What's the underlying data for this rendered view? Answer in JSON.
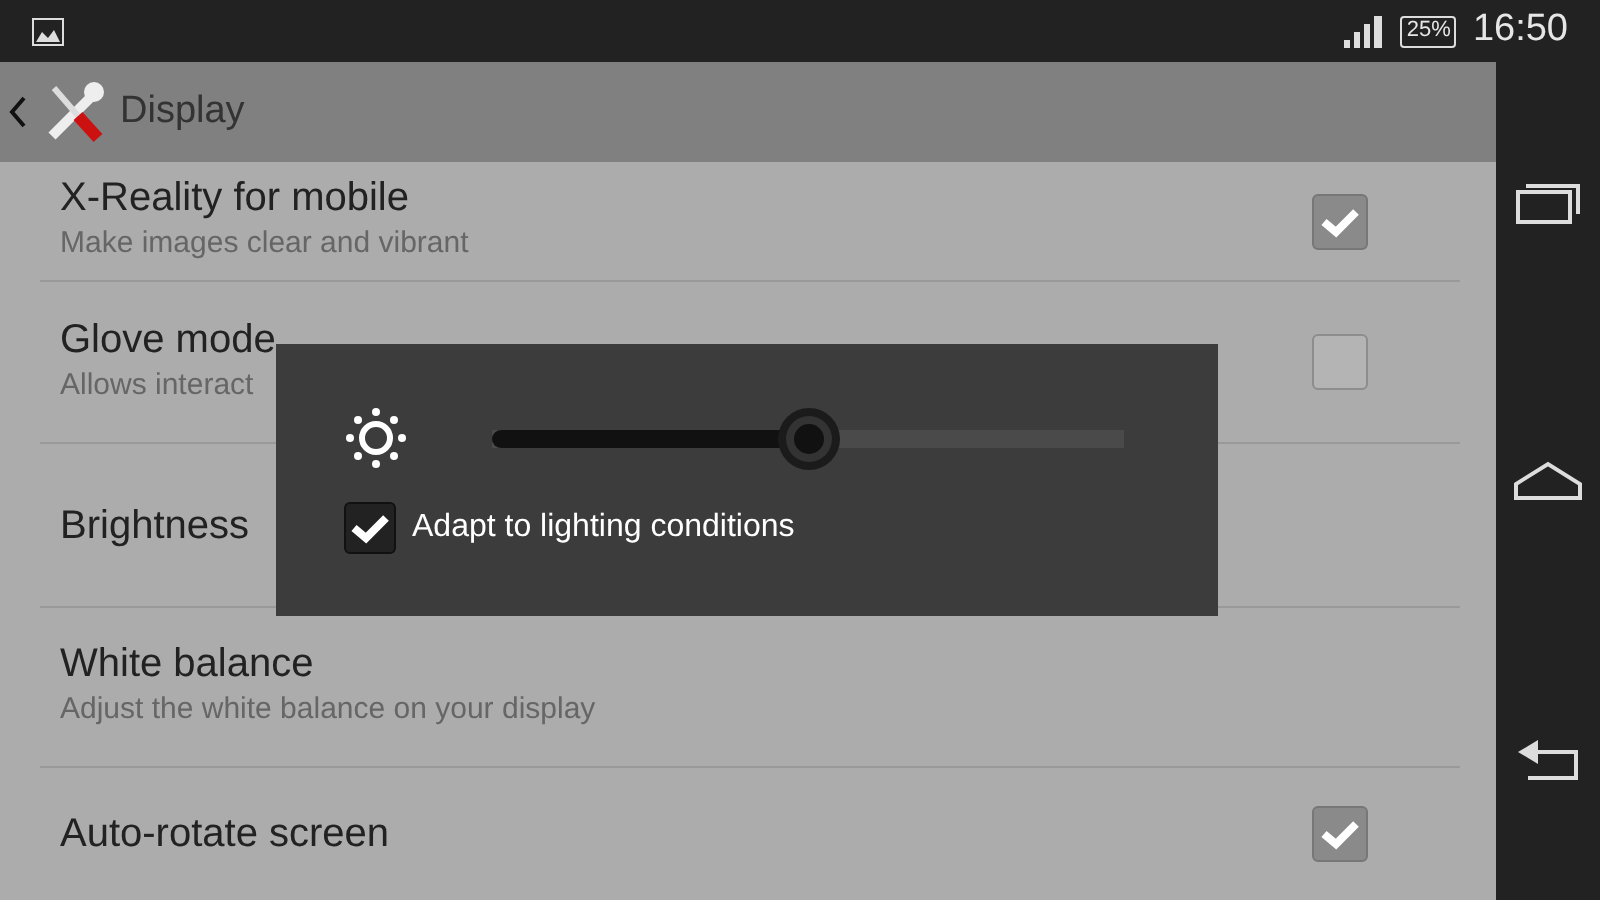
{
  "status_bar": {
    "battery": "25%",
    "time": "16:50"
  },
  "action_bar": {
    "title": "Display"
  },
  "settings": [
    {
      "title": "X-Reality for mobile",
      "summary": "Make images clear and vibrant",
      "checked": true
    },
    {
      "title": "Glove mode",
      "summary": "Allows interact",
      "checked": false
    },
    {
      "title": "Brightness"
    },
    {
      "title": "White balance",
      "summary": "Adjust the white balance on your display"
    },
    {
      "title": "Auto-rotate screen",
      "checked": true
    }
  ],
  "brightness_dialog": {
    "level": 0.5,
    "adapt": {
      "label": "Adapt to lighting conditions",
      "checked": true
    }
  }
}
